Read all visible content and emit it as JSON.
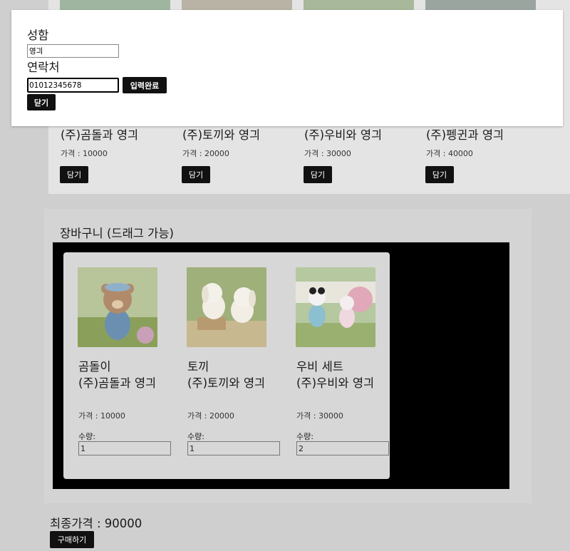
{
  "products": [
    {
      "company": "(주)곰돌과 영긔",
      "price": "가격 : 10000",
      "button": "담기"
    },
    {
      "company": "(주)토끼와 영긔",
      "price": "가격 : 20000",
      "button": "담기"
    },
    {
      "company": "(주)우비와 영긔",
      "price": "가격 : 30000",
      "button": "담기"
    },
    {
      "company": "(주)펭귄과 영긔",
      "price": "가격 : 40000",
      "button": "담기"
    }
  ],
  "cart": {
    "title": "장바구니 (드래그 가능)",
    "items": [
      {
        "name": "곰돌이",
        "company": "(주)곰돌과 영긔",
        "price": "가격 : 10000",
        "qty_label": "수량:",
        "qty": "1"
      },
      {
        "name": "토끼",
        "company": "(주)토끼와 영긔",
        "price": "가격 : 20000",
        "qty_label": "수량:",
        "qty": "1"
      },
      {
        "name": "우비 세트",
        "company": "(주)우비와 영긔",
        "price": "가격 : 30000",
        "qty_label": "수량:",
        "qty": "2"
      }
    ]
  },
  "total": "최종가격 : 90000",
  "buy_label": "구매하기",
  "modal": {
    "name_label": "성함",
    "name_value": "영긔",
    "phone_label": "연락처",
    "phone_value": "01012345678",
    "submit_label": "입력완료",
    "close_label": "닫기"
  }
}
